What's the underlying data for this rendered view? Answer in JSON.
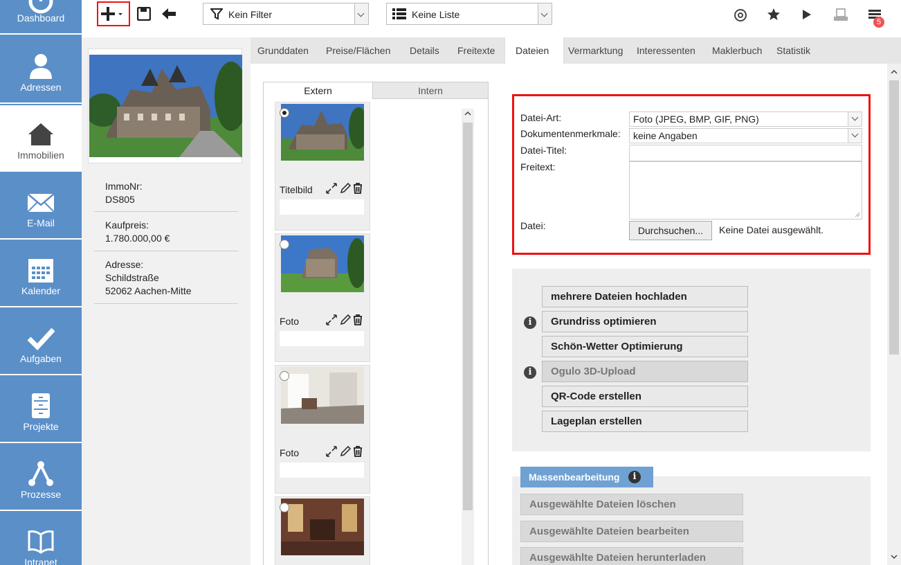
{
  "nav": {
    "items": [
      {
        "label": "Dashboard",
        "icon": "dashboard-icon"
      },
      {
        "label": "Adressen",
        "icon": "person-icon"
      },
      {
        "label": "Immobilien",
        "icon": "house-icon"
      },
      {
        "label": "E-Mail",
        "icon": "envelope-icon"
      },
      {
        "label": "Kalender",
        "icon": "calendar-icon"
      },
      {
        "label": "Aufgaben",
        "icon": "checkmark-icon"
      },
      {
        "label": "Projekte",
        "icon": "cabinet-icon"
      },
      {
        "label": "Prozesse",
        "icon": "process-icon"
      },
      {
        "label": "Intranet",
        "icon": "book-icon"
      }
    ]
  },
  "toolbar": {
    "filter_label": "Kein Filter",
    "list_label": "Keine Liste",
    "notification_count": "5"
  },
  "property": {
    "immonr_label": "ImmoNr:",
    "immonr": "DS805",
    "kaufpreis_label": "Kaufpreis:",
    "kaufpreis": "1.780.000,00 €",
    "adresse_label": "Adresse:",
    "street": "Schildstraße",
    "city": "52062 Aachen-Mitte"
  },
  "tabs": [
    "Grunddaten",
    "Preise/Flächen",
    "Details",
    "Freitexte",
    "Dateien",
    "Vermarktung",
    "Interessenten",
    "Maklerbuch",
    "Statistik"
  ],
  "files": {
    "tabs": [
      "Extern",
      "Intern"
    ],
    "cards": [
      {
        "caption": "Titelbild"
      },
      {
        "caption": "Foto"
      },
      {
        "caption": "Foto"
      },
      {
        "caption": ""
      }
    ]
  },
  "form": {
    "datei_art_label": "Datei-Art:",
    "datei_art_value": "Foto (JPEG, BMP, GIF, PNG)",
    "merkmale_label": "Dokumentenmerkmale:",
    "merkmale_value": "keine Angaben",
    "titel_label": "Datei-Titel:",
    "freitext_label": "Freitext:",
    "datei_label": "Datei:",
    "browse_label": "Durchsuchen...",
    "no_file": "Keine Datei ausgewählt."
  },
  "actions": [
    "mehrere Dateien hochladen",
    "Grundriss optimieren",
    "Schön-Wetter Optimierung",
    "Ogulo 3D-Upload",
    "QR-Code erstellen",
    "Lageplan erstellen"
  ],
  "mass": {
    "title": "Massenbearbeitung",
    "buttons": [
      "Ausgewählte Dateien löschen",
      "Ausgewählte Dateien bearbeiten",
      "Ausgewählte Dateien herunterladen"
    ]
  },
  "colors": {
    "sidebar": "#5b8fc8",
    "highlight": "#e11111",
    "mass_tab": "#6fa1d3"
  }
}
